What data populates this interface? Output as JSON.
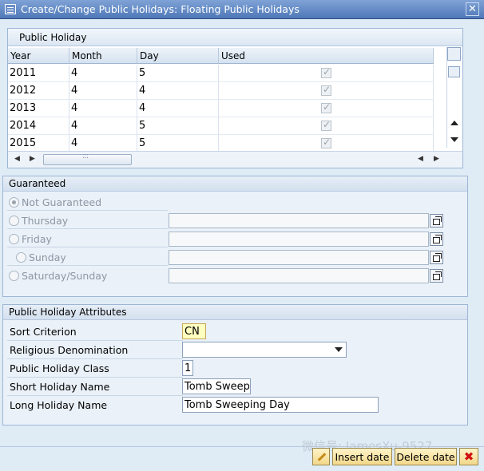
{
  "window": {
    "title": "Create/Change Public Holidays: Floating Public Holidays",
    "close_label": "✕"
  },
  "table": {
    "caption": "Public Holiday",
    "columns": [
      "Year",
      "Month",
      "Day",
      "Used"
    ],
    "rows": [
      {
        "year": "2011",
        "month": "4",
        "day": "5",
        "used": true
      },
      {
        "year": "2012",
        "month": "4",
        "day": "4",
        "used": true
      },
      {
        "year": "2013",
        "month": "4",
        "day": "4",
        "used": true
      },
      {
        "year": "2014",
        "month": "4",
        "day": "5",
        "used": true
      },
      {
        "year": "2015",
        "month": "4",
        "day": "5",
        "used": true
      }
    ],
    "hscroll_grip": ":::"
  },
  "guaranteed": {
    "title": "Guaranteed",
    "options": [
      {
        "label": "Not Guaranteed",
        "selected": true,
        "has_field": false
      },
      {
        "label": "Thursday",
        "selected": false,
        "has_field": true
      },
      {
        "label": "Friday",
        "selected": false,
        "has_field": true
      },
      {
        "label": "Sunday",
        "selected": false,
        "has_field": true
      },
      {
        "label": "Saturday/Sunday",
        "selected": false,
        "has_field": true
      }
    ]
  },
  "attributes": {
    "title": "Public Holiday Attributes",
    "sort_criterion": {
      "label": "Sort Criterion",
      "value": "CN"
    },
    "religious_denomination": {
      "label": "Religious Denomination",
      "value": ""
    },
    "holiday_class": {
      "label": "Public Holiday Class",
      "value": "1"
    },
    "short_name": {
      "label": "Short Holiday Name",
      "value": "Tomb Sweep"
    },
    "long_name": {
      "label": "Long Holiday Name",
      "value": "Tomb Sweeping Day"
    }
  },
  "footer": {
    "insert_label": "Insert date",
    "delete_label": "Delete date",
    "cancel_label": "✖",
    "watermark": "微信号: JamesXu-9527"
  },
  "colors": {
    "title_bar": "#4f78b8",
    "background": "#dfebf5",
    "button": "#f3d88a",
    "highlight_field": "#ffffc0"
  }
}
